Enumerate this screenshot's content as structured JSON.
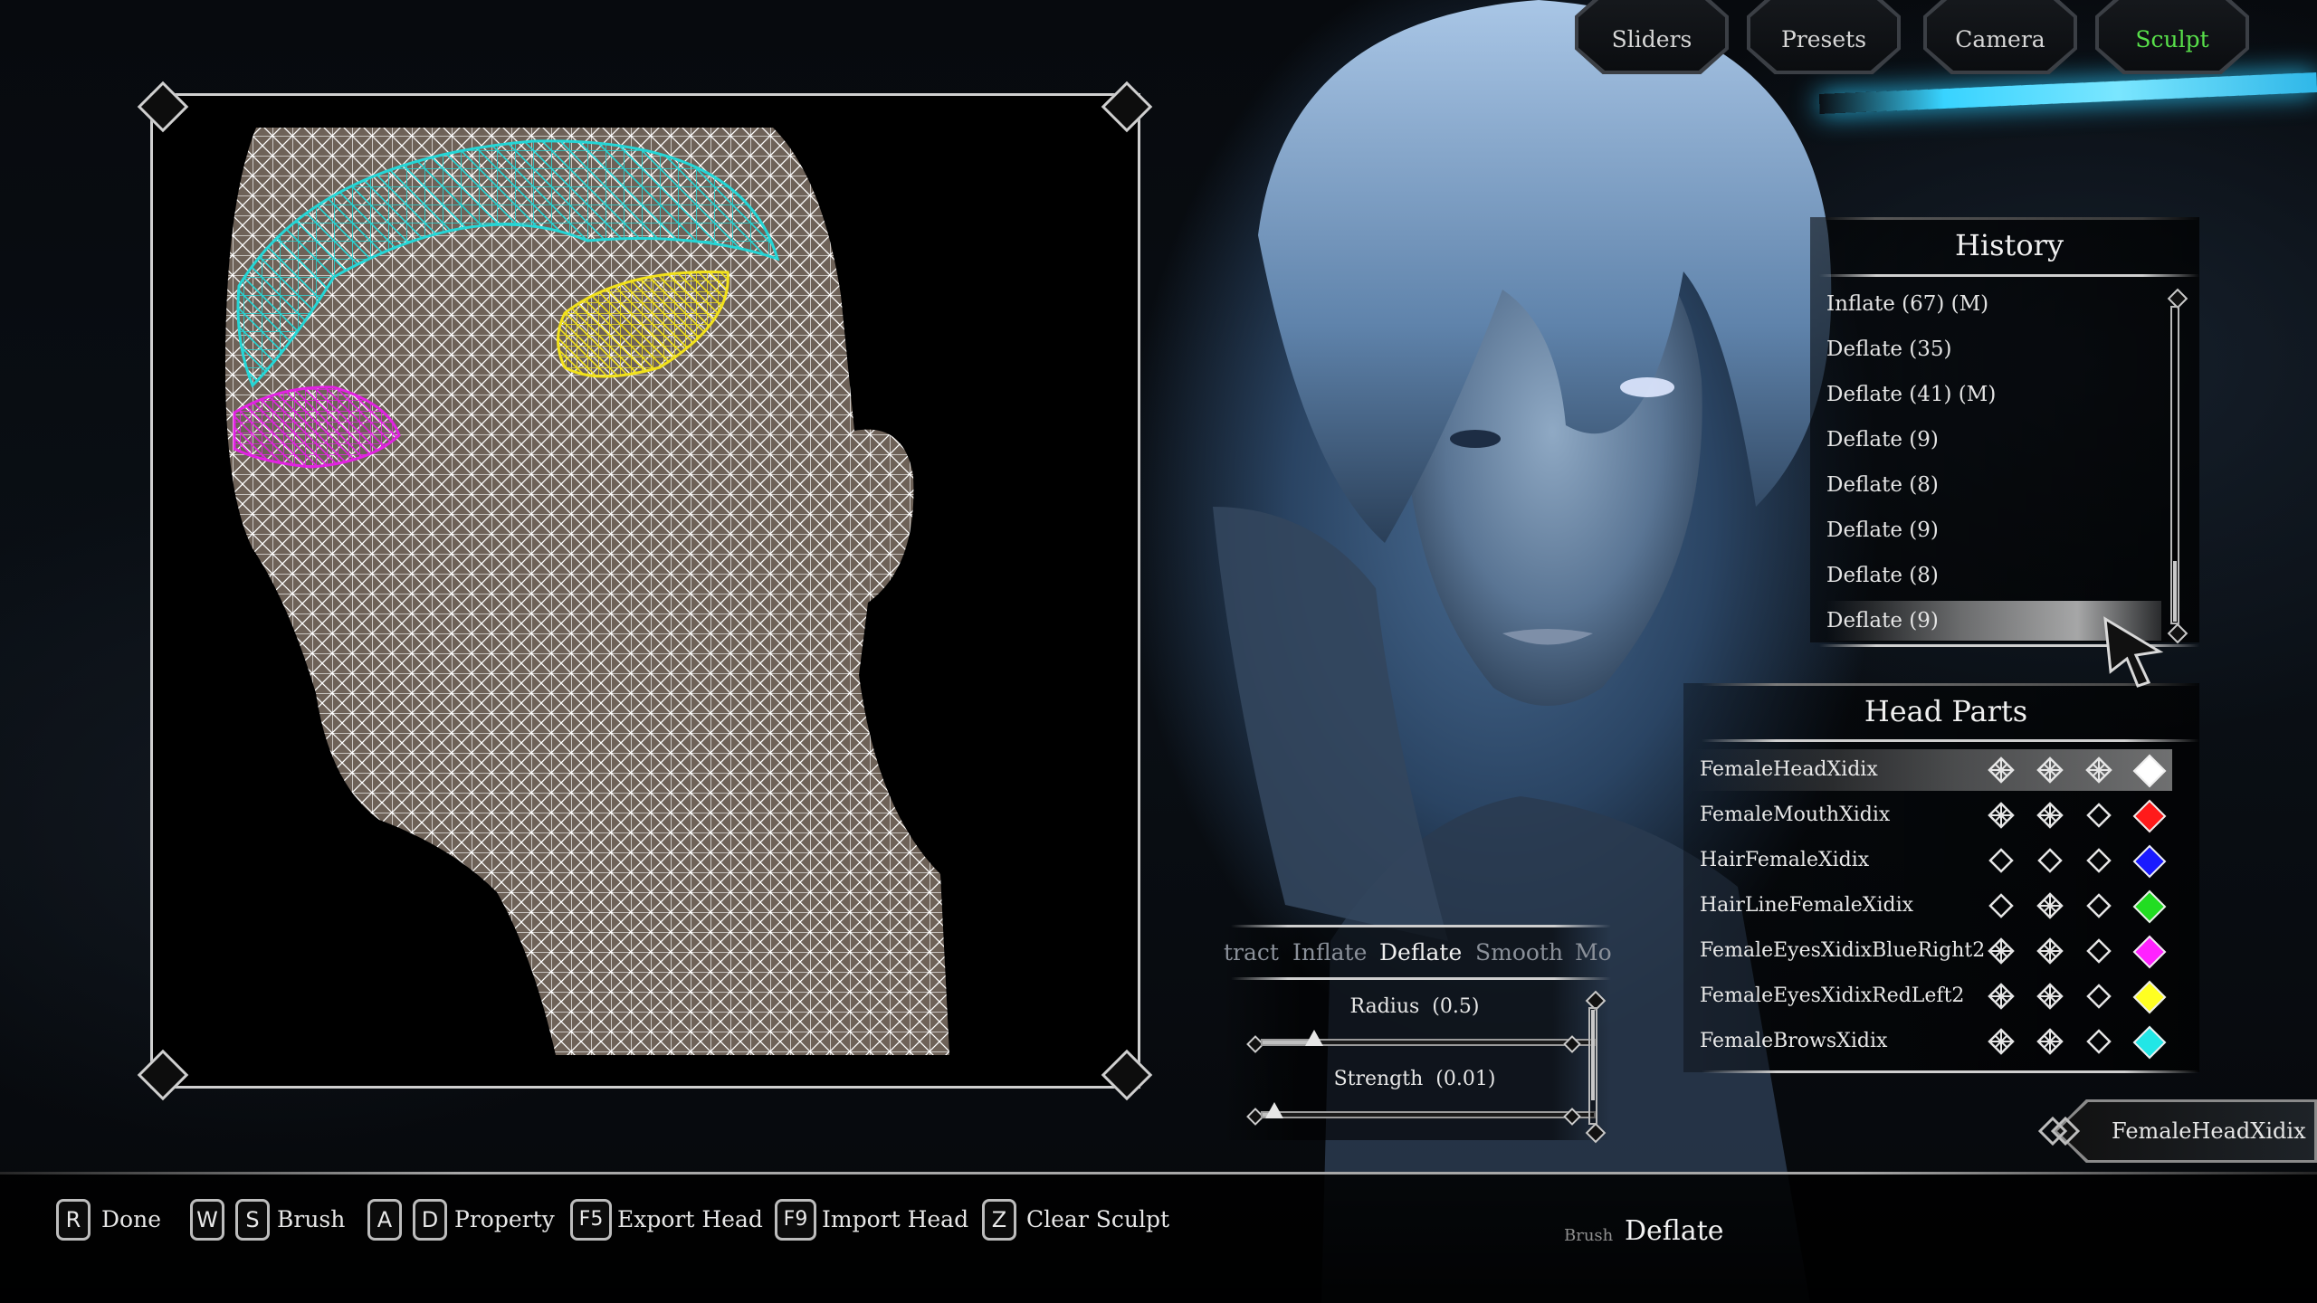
{
  "top_tabs": [
    {
      "label": "Sliders",
      "active": false
    },
    {
      "label": "Presets",
      "active": false
    },
    {
      "label": "Camera",
      "active": false
    },
    {
      "label": "Sculpt",
      "active": true
    }
  ],
  "history": {
    "title": "History",
    "items": [
      "Inflate (67) (M)",
      "Deflate (35)",
      "Deflate (41) (M)",
      "Deflate (9)",
      "Deflate (8)",
      "Deflate (9)",
      "Deflate (8)",
      "Deflate (9)"
    ],
    "selected_index": 7
  },
  "head_parts": {
    "title": "Head Parts",
    "items": [
      {
        "name": "FemaleHeadXidix",
        "icons": [
          "filled",
          "filled",
          "filled"
        ],
        "color": "#ffffff"
      },
      {
        "name": "FemaleMouthXidix",
        "icons": [
          "filled",
          "filled",
          "empty"
        ],
        "color": "#ff1a1a"
      },
      {
        "name": "HairFemaleXidix",
        "icons": [
          "empty",
          "empty",
          "empty"
        ],
        "color": "#1a1aff"
      },
      {
        "name": "HairLineFemaleXidix",
        "icons": [
          "empty",
          "filled",
          "empty"
        ],
        "color": "#22dd22"
      },
      {
        "name": "FemaleEyesXidixBlueRight2",
        "icons": [
          "filled",
          "filled",
          "empty"
        ],
        "color": "#ff22ff"
      },
      {
        "name": "FemaleEyesXidixRedLeft2",
        "icons": [
          "filled",
          "filled",
          "empty"
        ],
        "color": "#ffff22"
      },
      {
        "name": "FemaleBrowsXidix",
        "icons": [
          "filled",
          "filled",
          "empty"
        ],
        "color": "#22e6e6"
      }
    ],
    "selected_index": 0
  },
  "brush_tabs": [
    {
      "label": "tract",
      "active": false
    },
    {
      "label": "Inflate",
      "active": false
    },
    {
      "label": "Deflate",
      "active": true
    },
    {
      "label": "Smooth",
      "active": false
    },
    {
      "label": "Mo",
      "active": false
    }
  ],
  "sliders": [
    {
      "label": "Radius",
      "value_text": "(0.5)",
      "fraction": 0.16
    },
    {
      "label": "Strength",
      "value_text": "(0.01)",
      "fraction": 0.04
    }
  ],
  "selected_part": "FemaleHeadXidix",
  "hints": [
    {
      "keys": [
        "R"
      ],
      "label": "Done"
    },
    {
      "keys": [
        "W",
        "S"
      ],
      "label": "Brush"
    },
    {
      "keys": [
        "A",
        "D"
      ],
      "label": "Property"
    },
    {
      "keys": [
        "F5"
      ],
      "label": "Export Head"
    },
    {
      "keys": [
        "F9"
      ],
      "label": "Import Head"
    },
    {
      "keys": [
        "Z"
      ],
      "label": "Clear Sculpt"
    }
  ],
  "brush_status": {
    "caption": "Brush",
    "value": "Deflate"
  },
  "colors": {
    "active_tab": "#58e04a",
    "wire_white": "#ffffff",
    "wire_cyan": "#25d6d6",
    "wire_yellow": "#f2e21b",
    "wire_magenta": "#e222e2",
    "mesh_fill": "#6e6258",
    "accent_cyan": "#38d3ff"
  }
}
